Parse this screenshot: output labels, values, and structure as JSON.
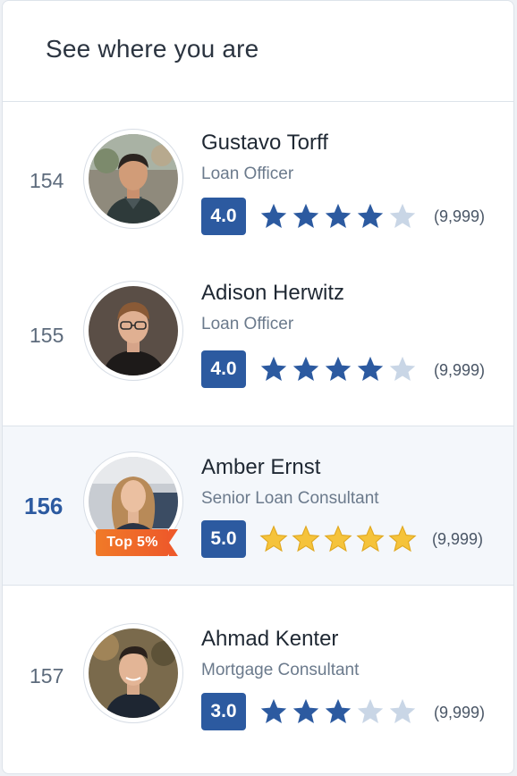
{
  "title": "See where you are",
  "colors": {
    "accent": "#2c5aa0",
    "star_filled": "#2c5aa0",
    "star_empty": "#c9d6e6",
    "star_gold": "#f5c33b",
    "badge": "#ef6a28"
  },
  "rows": [
    {
      "rank": "154",
      "name": "Gustavo Torff",
      "role": "Loan Officer",
      "score": "4.0",
      "stars_filled": 4,
      "count": "(9,999)",
      "badge": ""
    },
    {
      "rank": "155",
      "name": "Adison Herwitz",
      "role": "Loan Officer",
      "score": "4.0",
      "stars_filled": 4,
      "count": "(9,999)",
      "badge": ""
    },
    {
      "rank": "156",
      "name": "Amber Ernst",
      "role": "Senior Loan Consultant",
      "score": "5.0",
      "stars_filled": 5,
      "count": "(9,999)",
      "badge": "Top 5%"
    },
    {
      "rank": "157",
      "name": "Ahmad Kenter",
      "role": "Mortgage Consultant",
      "score": "3.0",
      "stars_filled": 3,
      "count": "(9,999)",
      "badge": ""
    }
  ]
}
